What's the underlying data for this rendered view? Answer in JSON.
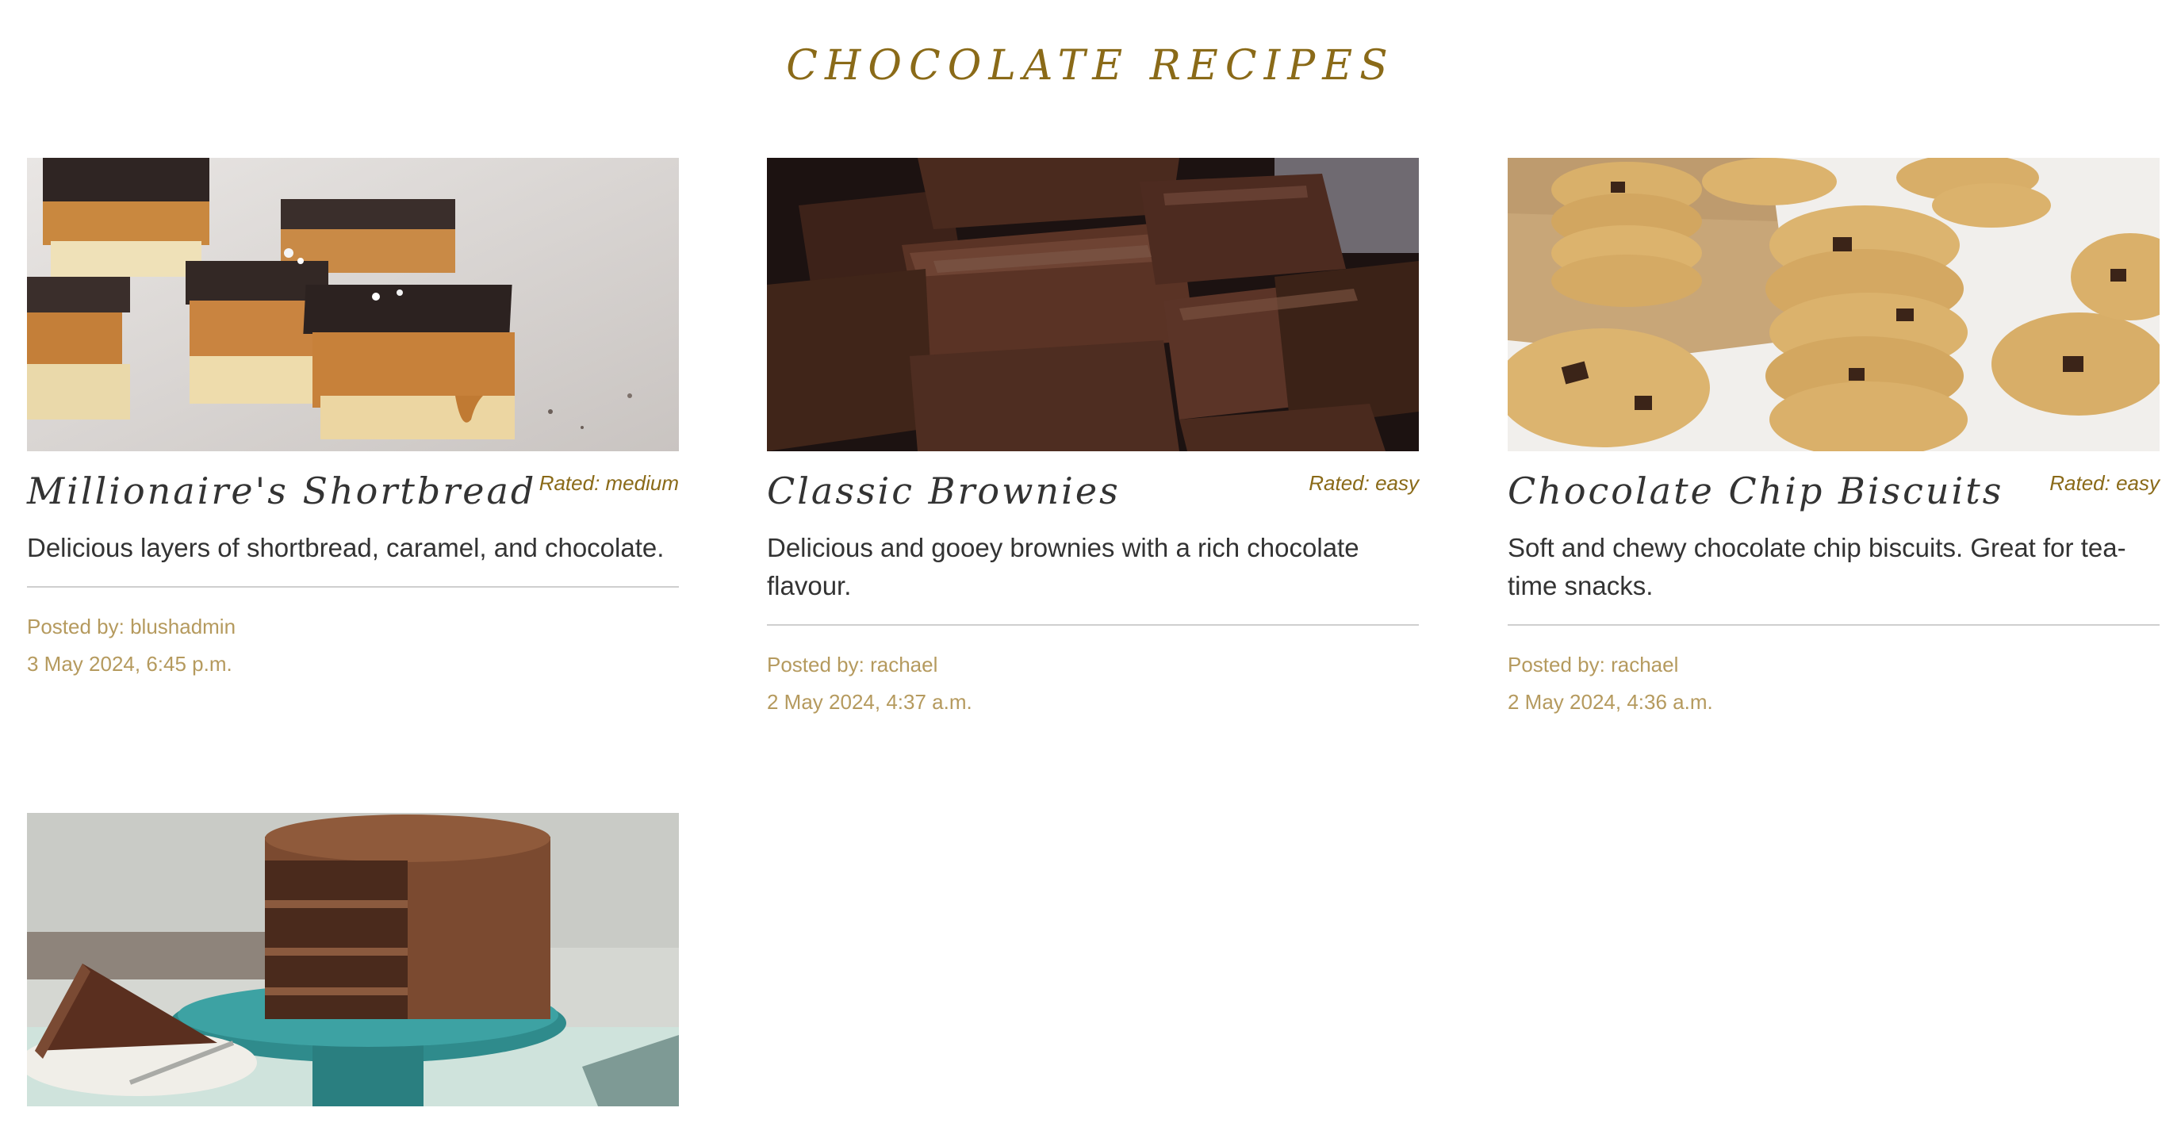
{
  "page": {
    "title": "CHOCOLATE RECIPES"
  },
  "recipes": [
    {
      "title": "Millionaire's Shortbread",
      "rating": "Rated: medium",
      "description": "Delicious layers of shortbread, caramel, and chocolate.",
      "posted_by": "Posted by: blushadmin",
      "date": "3 May 2024, 6:45 p.m."
    },
    {
      "title": "Classic Brownies",
      "rating": "Rated: easy",
      "description": "Delicious and gooey brownies with a rich chocolate flavour.",
      "posted_by": "Posted by: rachael",
      "date": "2 May 2024, 4:37 a.m."
    },
    {
      "title": "Chocolate Chip Biscuits",
      "rating": "Rated: easy",
      "description": "Soft and chewy chocolate chip biscuits. Great for tea-time snacks.",
      "posted_by": "Posted by: rachael",
      "date": "2 May 2024, 4:36 a.m."
    }
  ],
  "colors": {
    "accent": "#8a6a18",
    "meta": "#b59a5e",
    "text": "#333333",
    "divider": "#cfcfcf"
  }
}
